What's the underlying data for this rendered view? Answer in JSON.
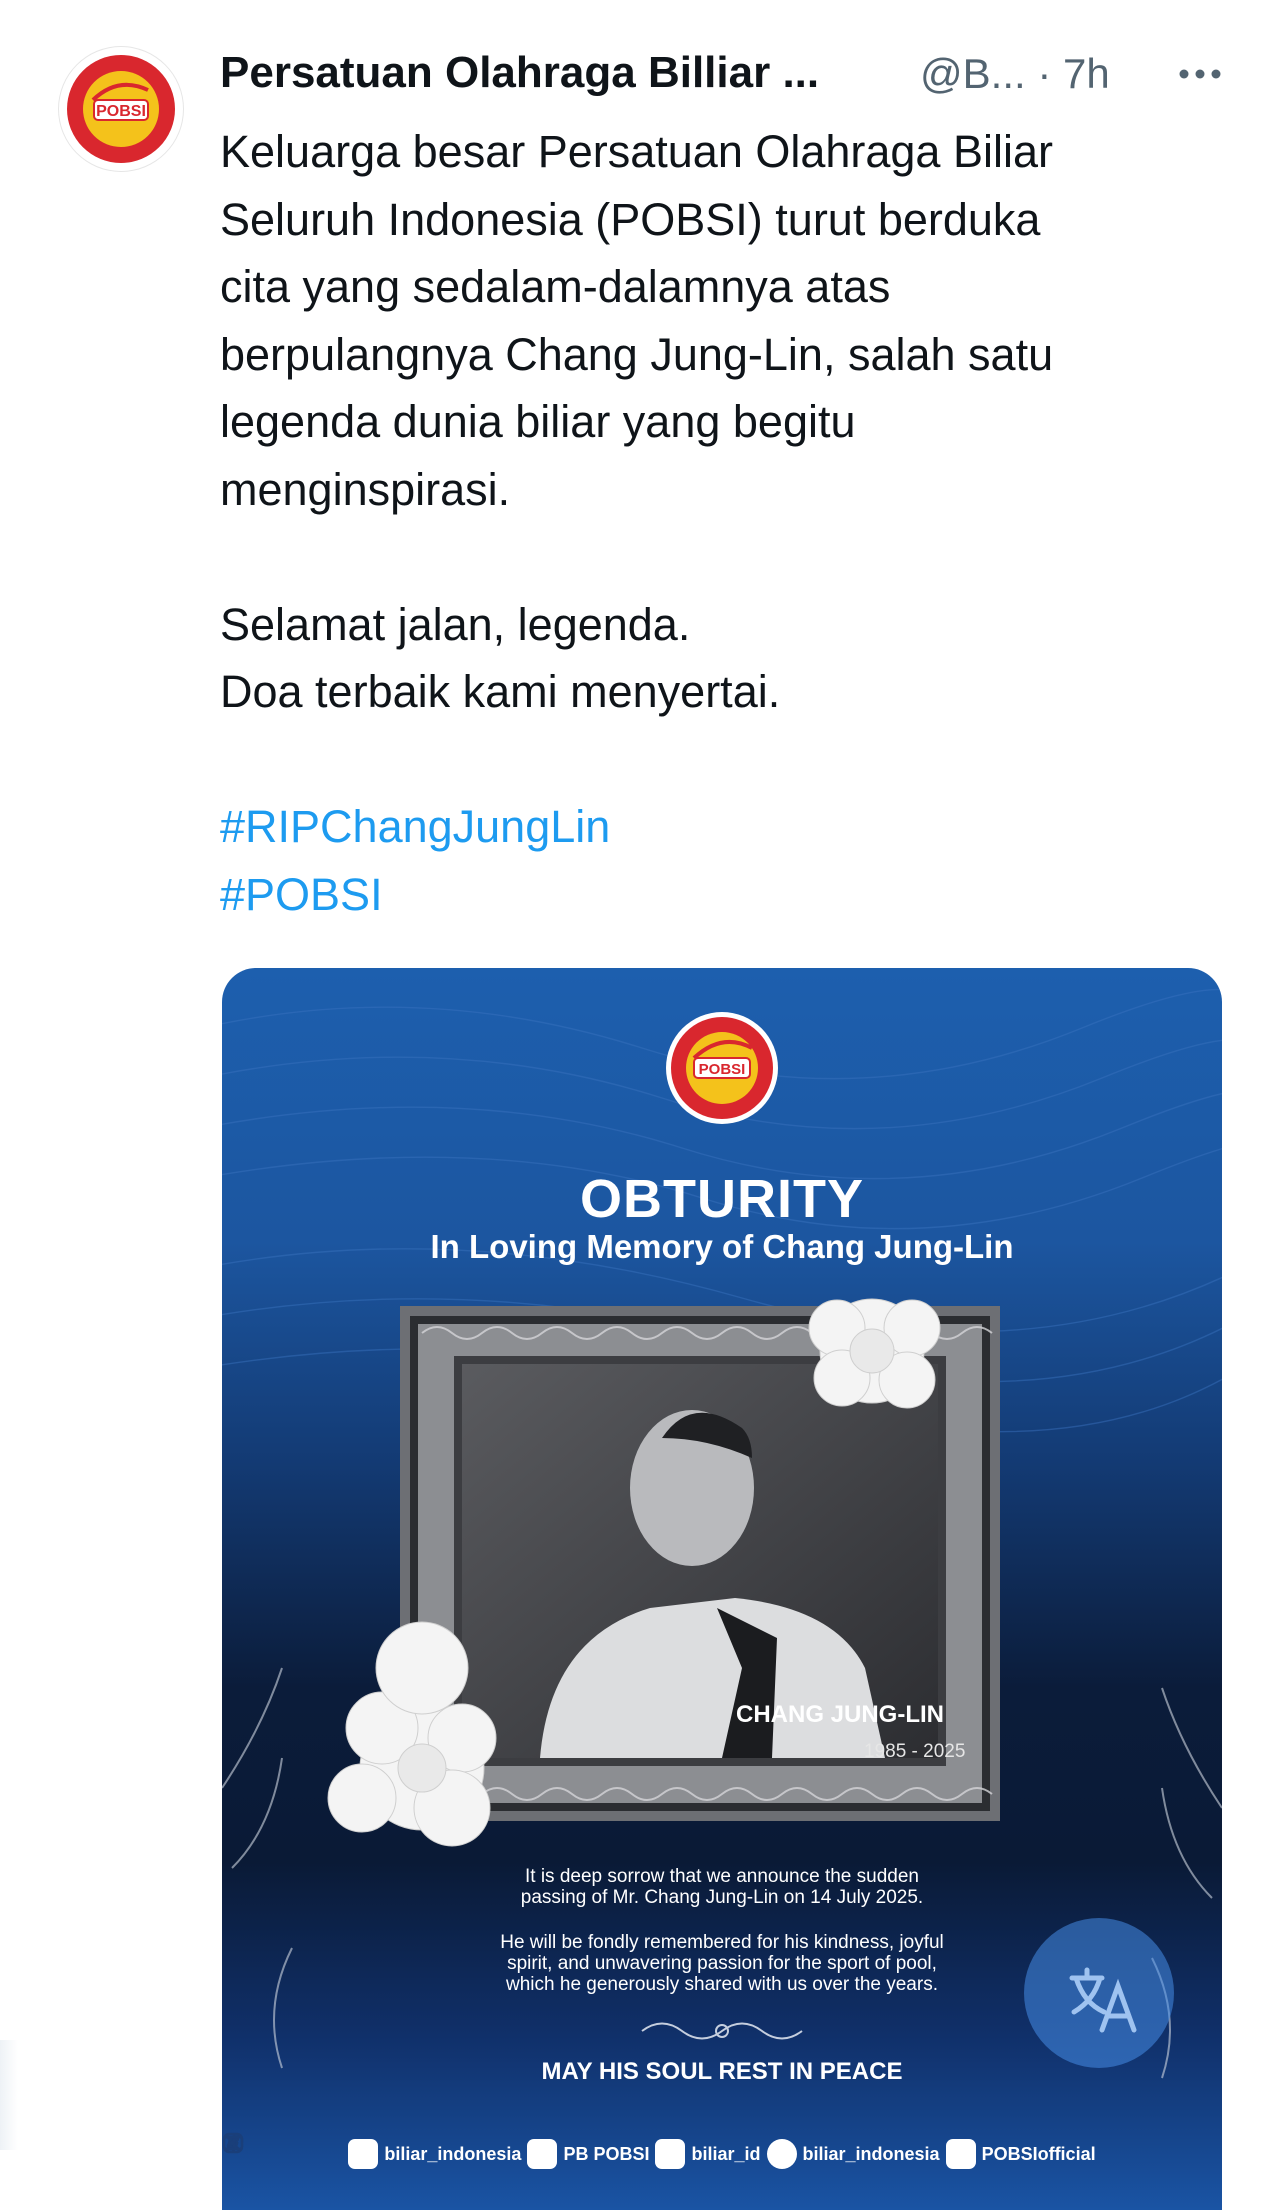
{
  "author": {
    "name": "Persatuan Olahraga Billiar ...",
    "handle": "@B...",
    "separator": "·",
    "time": "7h",
    "avatar_label": "POBSI"
  },
  "tweet": {
    "lines": [
      "Keluarga besar Persatuan Olahraga Biliar",
      "Seluruh Indonesia (POBSI) turut berduka",
      "cita yang sedalam-dalamnya atas",
      "berpulangnya Chang Jung-Lin, salah satu",
      "legenda dunia biliar yang begitu",
      "menginspirasi."
    ],
    "farewell": [
      "Selamat jalan, legenda.",
      "Doa terbaik kami menyertai."
    ],
    "hashtags": [
      "#RIPChangJungLin",
      "#POBSI"
    ]
  },
  "media": {
    "logo_text": "POBSI",
    "title": "OBTURITY",
    "subtitle": "In Loving Memory of Chang Jung-Lin",
    "name": "CHANG JUNG-LIN",
    "years": "1985 - 2025",
    "announcement": [
      "It is deep sorrow that we announce the sudden",
      "passing of Mr. Chang Jung-Lin on 14 July 2025."
    ],
    "tribute": [
      "He will be fondly remembered for his kindness, joyful",
      "spirit, and unwavering passion for the sport of pool,",
      "which he generously shared with us over the years."
    ],
    "closing": "MAY HIS SOUL REST IN PEACE",
    "socials": [
      {
        "icon": "instagram-icon",
        "label": "biliar_indonesia"
      },
      {
        "icon": "facebook-icon",
        "label": "PB POBSI"
      },
      {
        "icon": "x-icon",
        "label": "biliar_id"
      },
      {
        "icon": "tiktok-icon",
        "label": "biliar_indonesia"
      },
      {
        "icon": "youtube-icon",
        "label": "POBSIofficial"
      }
    ]
  },
  "colors": {
    "text": "#0f1419",
    "muted": "#536471",
    "hashtag": "#1d9bf0",
    "media_blue": "#1d5fae",
    "media_dark": "#0a1a36"
  }
}
